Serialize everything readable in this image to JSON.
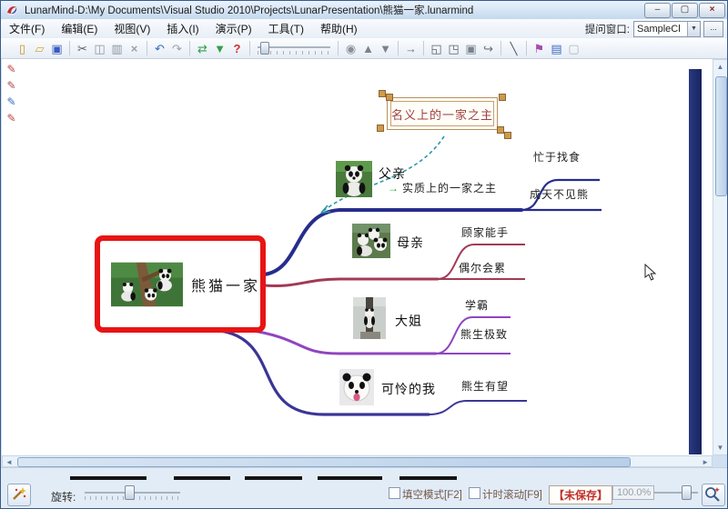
{
  "window": {
    "title": "LunarMind-D:\\My Documents\\Visual Studio 2010\\Projects\\LunarPresentation\\熊猫一家.lunarmind",
    "minimize_glyph": "–",
    "maximize_glyph": "▢",
    "close_glyph": "×"
  },
  "menubar": {
    "items": [
      {
        "label": "文件(F)"
      },
      {
        "label": "编辑(E)"
      },
      {
        "label": "视图(V)"
      },
      {
        "label": "插入(I)"
      },
      {
        "label": "演示(P)"
      },
      {
        "label": "工具(T)"
      },
      {
        "label": "帮助(H)"
      }
    ],
    "prompt_label": "提问窗口:",
    "prompt_value": "SampleCl",
    "combo_arrow": "▼",
    "more_button": "..."
  },
  "toolbar": {
    "icons": [
      {
        "name": "new-file",
        "glyph": "▯",
        "color": "#c8922a"
      },
      {
        "name": "open-folder",
        "glyph": "▱",
        "color": "#d8a43a"
      },
      {
        "name": "save",
        "glyph": "▣",
        "color": "#3a5ac0"
      },
      {
        "name": "cut",
        "glyph": "✂",
        "color": "#555c66"
      },
      {
        "name": "copy",
        "glyph": "◫",
        "color": "#8a93a0"
      },
      {
        "name": "paste",
        "glyph": "▥",
        "color": "#8a93a0"
      },
      {
        "name": "delete",
        "glyph": "×",
        "color": "#9aa0a8"
      },
      {
        "name": "undo",
        "glyph": "↶",
        "color": "#3a6bc0"
      },
      {
        "name": "redo",
        "glyph": "↷",
        "color": "#9aa4ae"
      },
      {
        "name": "convert",
        "glyph": "⇄",
        "color": "#2fa04a"
      },
      {
        "name": "filter",
        "glyph": "▼",
        "color": "#2fa04a"
      },
      {
        "name": "help",
        "glyph": "?",
        "color": "#d03030"
      },
      {
        "name": "view",
        "glyph": "◉",
        "color": "#8a909a"
      },
      {
        "name": "expand-all",
        "glyph": "▲",
        "color": "#79828e"
      },
      {
        "name": "collapse-all",
        "glyph": "▼",
        "color": "#79828e"
      },
      {
        "name": "jump-to",
        "glyph": "→",
        "color": "#6a7280"
      },
      {
        "name": "bring-front",
        "glyph": "◱",
        "color": "#5a626e"
      },
      {
        "name": "send-back",
        "glyph": "◳",
        "color": "#5a626e"
      },
      {
        "name": "fill-shape",
        "glyph": "▣",
        "color": "#7a828e"
      },
      {
        "name": "curve-arrow",
        "glyph": "↪",
        "color": "#6a7280"
      },
      {
        "name": "draw-line",
        "glyph": "╲",
        "color": "#4a5568"
      },
      {
        "name": "flag",
        "glyph": "⚑",
        "color": "#a84ab0"
      },
      {
        "name": "notes-panel",
        "glyph": "▤",
        "color": "#3a6bc0"
      },
      {
        "name": "window-panel",
        "glyph": "▢",
        "color": "#aab4be"
      }
    ]
  },
  "left_tools": {
    "icons": [
      {
        "name": "pen-tool-1",
        "glyph": "✎",
        "color": "#c04040"
      },
      {
        "name": "pen-tool-2",
        "glyph": "✎",
        "color": "#b04848"
      },
      {
        "name": "pen-tool-3",
        "glyph": "✎",
        "color": "#3a6bc0"
      },
      {
        "name": "pen-tool-4",
        "glyph": "✎",
        "color": "#c04040"
      }
    ]
  },
  "mindmap": {
    "floating_topic": {
      "label": "名义上的一家之主"
    },
    "root": {
      "label": "熊猫一家"
    },
    "branches": [
      {
        "label": "父亲",
        "note_arrow": "→",
        "note": "实质上的一家之主",
        "color": "#262d8c",
        "leaves": [
          "忙于找食",
          "成天不见熊"
        ]
      },
      {
        "label": "母亲",
        "color": "#a23a55",
        "leaves": [
          "顾家能手",
          "偶尔会累"
        ]
      },
      {
        "label": "大姐",
        "color": "#8f45c0",
        "leaves": [
          "学霸",
          "熊生极致"
        ]
      },
      {
        "label": "可怜的我",
        "color": "#3b3596",
        "leaves": [
          "熊生有望"
        ]
      }
    ],
    "colors": {
      "root_border": "#e81414",
      "floating_border": "#b8905a",
      "floating_text": "#a04040",
      "callout_arrow": "#2a9aa8",
      "page_edge": "#1b2a70"
    }
  },
  "bottombar": {
    "rotate_label": "旋转:",
    "fill_mode_label": "填空模式[F2]",
    "timed_scroll_label": "计时滚动[F9]",
    "unsaved_label": "【未保存】",
    "zoom_value": "100.0%"
  }
}
